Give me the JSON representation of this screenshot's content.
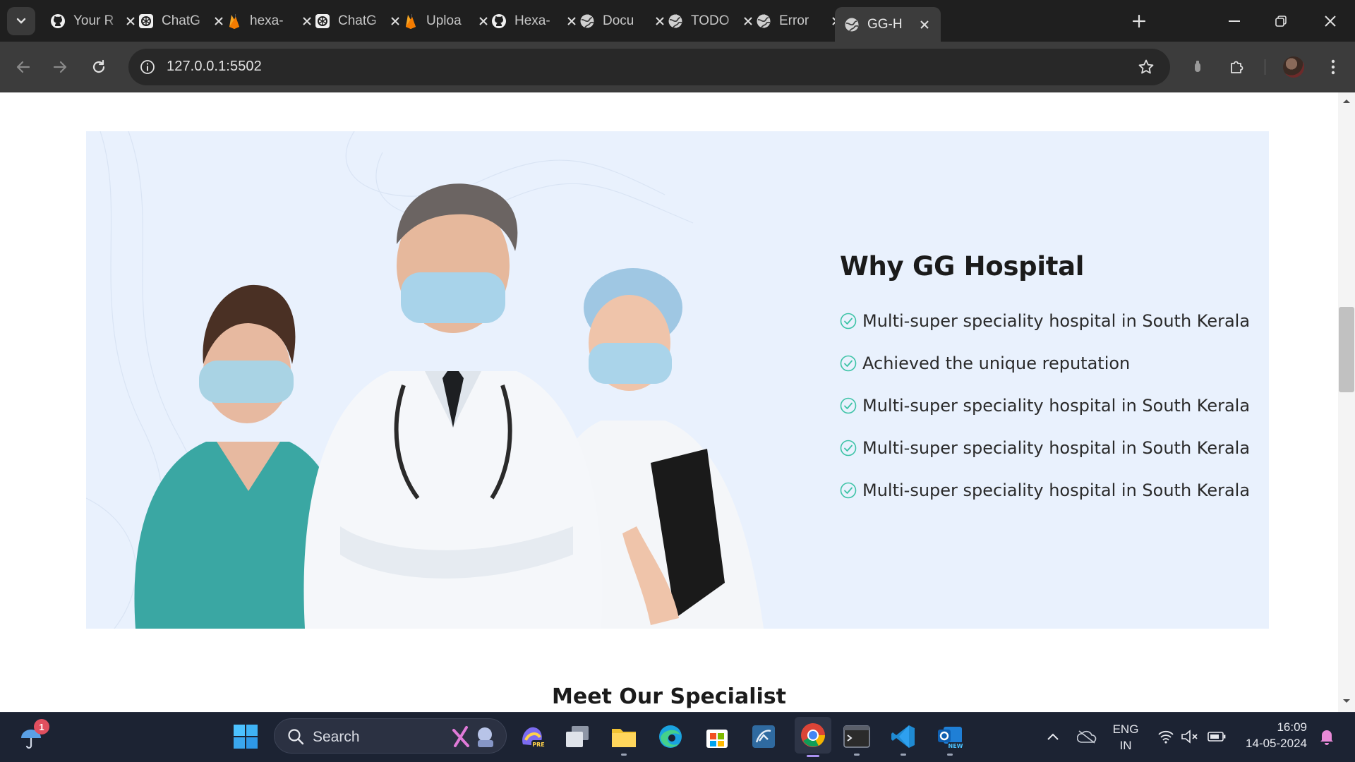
{
  "browser": {
    "tabs": [
      {
        "label": "Your R",
        "icon": "github-icon"
      },
      {
        "label": "ChatG",
        "icon": "openai-icon"
      },
      {
        "label": "hexa-",
        "icon": "firebase-icon"
      },
      {
        "label": "ChatG",
        "icon": "openai-icon"
      },
      {
        "label": "Uploa",
        "icon": "firebase-icon"
      },
      {
        "label": "Hexa-",
        "icon": "github-icon"
      },
      {
        "label": "Docu",
        "icon": "globe-icon"
      },
      {
        "label": "TODO",
        "icon": "globe-icon"
      },
      {
        "label": "Error",
        "icon": "globe-icon"
      },
      {
        "label": "GG-H",
        "icon": "globe-icon"
      }
    ],
    "active_tab": 9,
    "url": "127.0.0.1:5502"
  },
  "page": {
    "why_title": "Why GG Hospital",
    "why_points": [
      "Multi-super speciality hospital in South Kerala",
      "Achieved the unique reputation",
      "Multi-super speciality hospital in South Kerala",
      "Multi-super speciality hospital in South Kerala",
      "Multi-super speciality hospital in South Kerala"
    ],
    "specialist_heading": "Meet Our Specialist",
    "accent_color": "#3cc3a6",
    "hero_bg": "#e9f1fd"
  },
  "taskbar": {
    "search_label": "Search",
    "notification_count": "1",
    "language": "ENG",
    "region": "IN",
    "time": "16:09",
    "date": "14-05-2024"
  }
}
